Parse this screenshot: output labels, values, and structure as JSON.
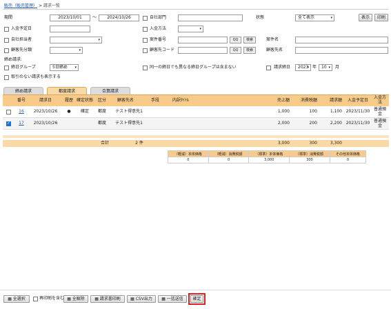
{
  "breadcrumb": {
    "parent": "販売（販売管理）",
    "sep": ">",
    "current": "請求一覧"
  },
  "filters": {
    "period_label": "期間",
    "date_from": "2023/10/01",
    "tilde": "～",
    "date_to": "2024/10/26",
    "dept_label": "自社部門",
    "status_label": "状態",
    "status_value": "全て表示",
    "display_btn": "表示",
    "print_btn": "印刷",
    "due_date_label": "入金予定日",
    "pay_method_label": "入金方法",
    "owner_label": "自社担当者",
    "case_no_label": "案件番号",
    "case_search": "検索",
    "case_name_label": "案件名",
    "client_cat_label": "顧客先分類",
    "client_code_label": "顧客先コード",
    "client_search": "検索",
    "client_name_label": "顧客先名",
    "search_icon_text": "QQ"
  },
  "billing_date": {
    "title": "締め請求:",
    "group_label": "締日グループ",
    "group_value": "5日締め",
    "exclude_label": "同一の締日でも異なる締日グループは含まない",
    "closing_label": "請求締日",
    "year": "2023",
    "year_unit": "年",
    "month": "10",
    "month_unit": "月",
    "show_none_label": "取引のない請求も表示する"
  },
  "tabs": [
    "締め請求",
    "都度請求",
    "合算請求"
  ],
  "table": {
    "headers": [
      "番号",
      "請求日",
      "履歴",
      "確定状態",
      "区分",
      "顧客先名",
      "手段",
      "内訳ﾀｲﾄﾙ",
      "売上額",
      "消費税額",
      "請求額",
      "入金予定日",
      "入金方法"
    ],
    "rows": [
      {
        "no": "16",
        "date": "2023/10/26",
        "history": "●",
        "status": "確定",
        "kind": "都度",
        "client": "テスト得意先1",
        "method": "",
        "breakdown": "",
        "sales": "1,000",
        "tax": "100",
        "amount": "1,100",
        "due": "2023/11/30",
        "pay": "普通預金"
      },
      {
        "no": "17",
        "date": "2023/10/26",
        "history": "",
        "status": "",
        "kind": "都度",
        "client": "テスト得意先1",
        "method": "",
        "breakdown": "",
        "sales": "2,000",
        "tax": "200",
        "amount": "2,200",
        "due": "2023/11/30",
        "pay": "普通預金"
      }
    ],
    "total_label": "合計",
    "total_count": "2 件",
    "total_sales": "3,000",
    "total_tax": "300",
    "total_amount": "3,300"
  },
  "tax_summary": {
    "headers": [
      "（軽減）本体価格",
      "（軽減）消費税額",
      "（標準）本体価格",
      "（標準）消費税額",
      "その他本体価格"
    ],
    "values": [
      "0",
      "0",
      "3,000",
      "300",
      "0"
    ]
  },
  "footer": {
    "select_all": "全選択",
    "include_resend": "再印刷を含む",
    "deselect_all": "全解除",
    "print_invoice": "請求書印刷",
    "csv_output": "CSV出力",
    "batch_send": "一括送信",
    "confirm": "確定"
  },
  "colors": {
    "accent": "#f9cb8a",
    "link": "#2256a6",
    "highlight_border": "#e02020"
  }
}
